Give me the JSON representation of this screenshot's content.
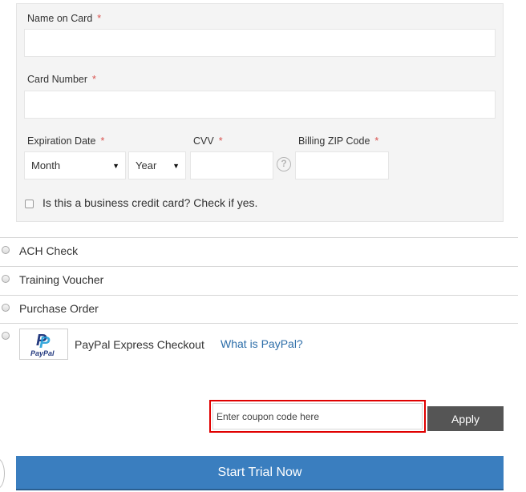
{
  "card_form": {
    "name_on_card": {
      "label": "Name on Card",
      "required_mark": "*",
      "value": ""
    },
    "card_number": {
      "label": "Card Number",
      "required_mark": "*",
      "value": ""
    },
    "expiration_date": {
      "label": "Expiration Date",
      "required_mark": "*",
      "month_selected": "Month",
      "year_selected": "Year"
    },
    "cvv": {
      "label": "CVV",
      "required_mark": "*",
      "value": "",
      "help_glyph": "?"
    },
    "billing_zip": {
      "label": "Billing ZIP Code",
      "required_mark": "*",
      "value": ""
    },
    "business_card": {
      "label": "Is this a business credit card? Check if yes.",
      "checked": false
    }
  },
  "payment_options": [
    {
      "label": "ACH Check",
      "selected": false
    },
    {
      "label": "Training Voucher",
      "selected": false
    },
    {
      "label": "Purchase Order",
      "selected": false
    },
    {
      "label": "PayPal Express Checkout",
      "selected": false,
      "logo_text": "PayPal",
      "info_link": "What is PayPal?"
    }
  ],
  "coupon": {
    "placeholder": "Enter coupon code here",
    "value": "",
    "apply_label": "Apply"
  },
  "submit": {
    "label": "Start Trial Now"
  },
  "colors": {
    "required_star": "#d9534f",
    "link": "#2d6ea9",
    "apply_button": "#555555",
    "primary_button": "#3a7ebf",
    "highlight_border": "#e00000",
    "paypal_dark": "#253b80",
    "paypal_light": "#179bd7"
  }
}
